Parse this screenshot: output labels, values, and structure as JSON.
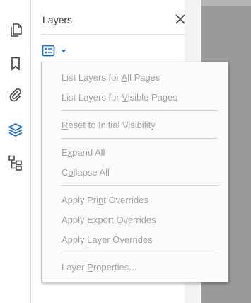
{
  "panel": {
    "title": "Layers"
  },
  "menu": {
    "items": [
      {
        "pre": "List Layers for ",
        "u": "A",
        "post": "ll Pages"
      },
      {
        "pre": "List Layers for ",
        "u": "V",
        "post": "isible Pages"
      },
      {
        "pre": "",
        "u": "R",
        "post": "eset to Initial Visibility"
      },
      {
        "pre": "E",
        "u": "x",
        "post": "pand All"
      },
      {
        "pre": "C",
        "u": "o",
        "post": "llapse All"
      },
      {
        "pre": "Apply Pri",
        "u": "n",
        "post": "t Overrides"
      },
      {
        "pre": "Apply ",
        "u": "E",
        "post": "xport Overrides"
      },
      {
        "pre": "Apply ",
        "u": "L",
        "post": "ayer Overrides"
      },
      {
        "pre": "Layer ",
        "u": "P",
        "post": "roperties..."
      }
    ]
  },
  "colors": {
    "accent": "#1a6ec9",
    "disabled_text": "#a3a3a3",
    "document_background": "#9a9a9a"
  },
  "icons": {
    "rail": [
      "pages-icon",
      "bookmark-icon",
      "attachment-icon",
      "layers-icon",
      "structure-tree-icon"
    ],
    "panel": [
      "close-icon",
      "layer-options-icon",
      "chevron-down-icon"
    ]
  }
}
